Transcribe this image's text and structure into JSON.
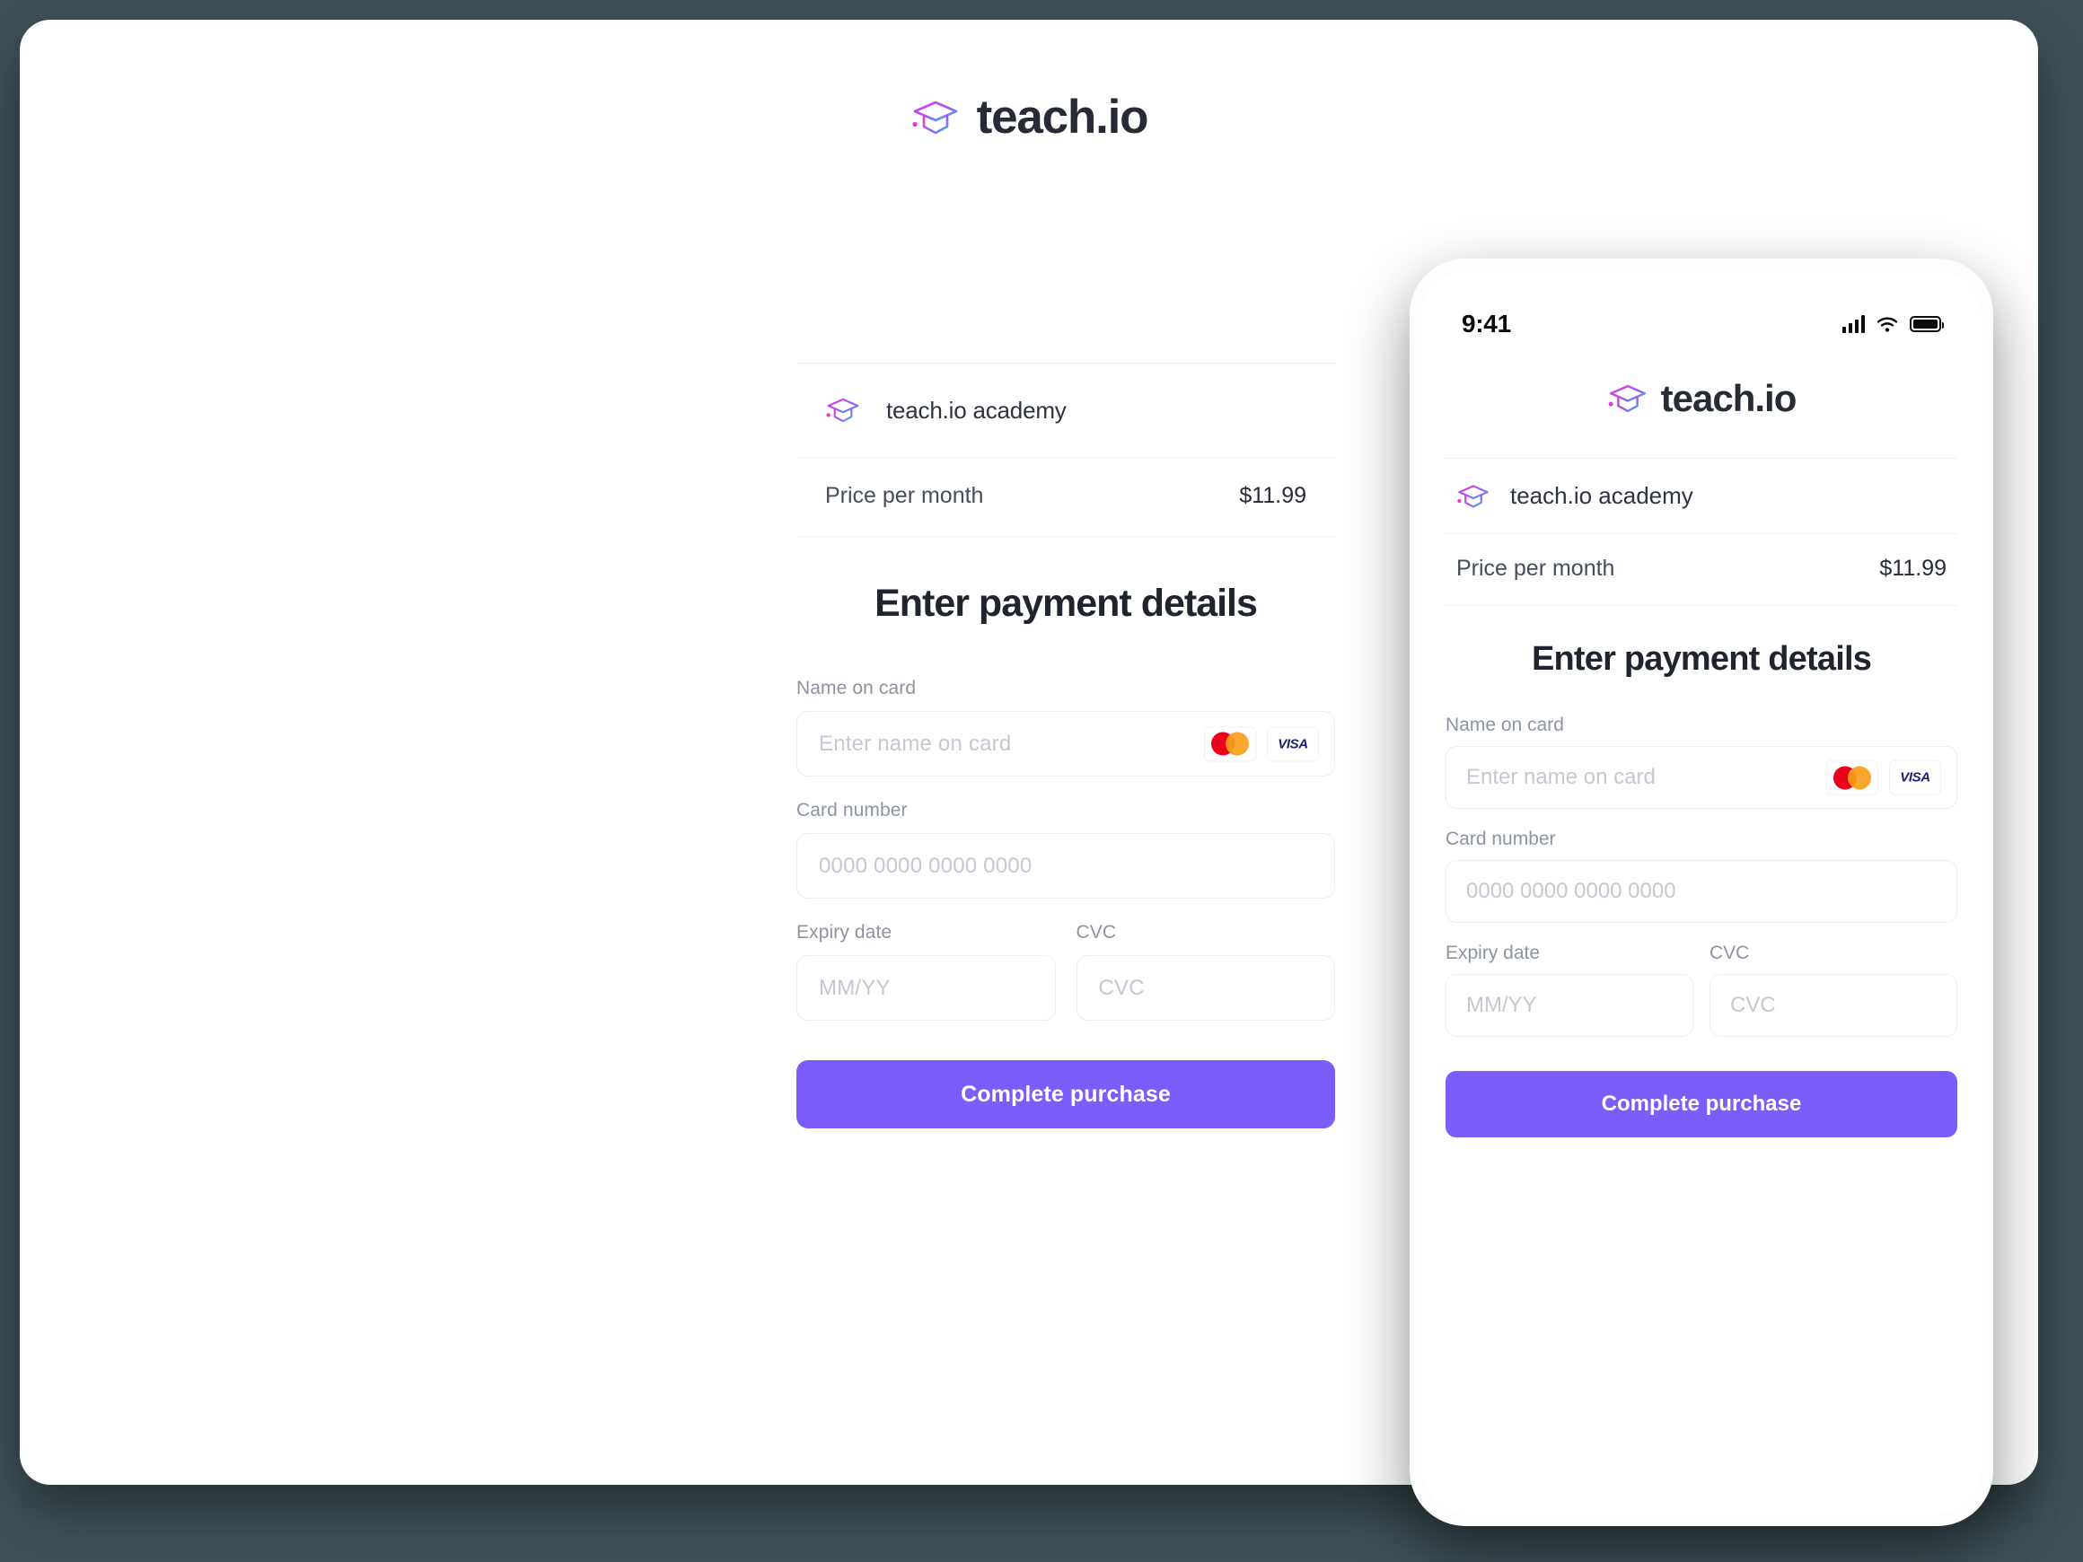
{
  "brand": {
    "name": "teach.io",
    "logo_icon": "graduation-cap-icon",
    "gradient_from": "#e838d8",
    "gradient_to": "#35b6f2"
  },
  "theme": {
    "background": "#3f5159",
    "surface": "#ffffff",
    "accent": "#7c5cfa",
    "text_primary": "#1f242e",
    "text_secondary": "#464d5c",
    "text_muted": "#8d94a1",
    "placeholder": "#c3c8d1",
    "border": "#eceef2",
    "divider": "#f1f2f5"
  },
  "desktop": {
    "checkout": {
      "merchant_name": "teach.io academy",
      "merchant_icon": "graduation-cap-icon",
      "price_label": "Price per month",
      "price_value": "$11.99",
      "section_title": "Enter payment details",
      "fields": [
        {
          "id": "name-on-card",
          "label": "Name on card",
          "placeholder": "Enter name on card",
          "value": ""
        },
        {
          "id": "card-number",
          "label": "Card number",
          "placeholder": "0000 0000 0000 0000",
          "value": ""
        },
        {
          "id": "expiry-date",
          "label": "Expiry date",
          "placeholder": "MM/YY",
          "value": ""
        },
        {
          "id": "cvc",
          "label": "CVC",
          "placeholder": "CVC",
          "value": ""
        }
      ],
      "card_brands": [
        {
          "name": "mastercard-icon",
          "label": ""
        },
        {
          "name": "visa-icon",
          "label": "VISA"
        }
      ],
      "submit_label": "Complete purchase"
    }
  },
  "mobile": {
    "status_bar": {
      "time": "9:41",
      "signal_icon": "cellular-signal-icon",
      "wifi_icon": "wifi-icon",
      "battery_icon": "battery-full-icon"
    },
    "brand_name": "teach.io",
    "checkout": {
      "merchant_name": "teach.io academy",
      "merchant_icon": "graduation-cap-icon",
      "price_label": "Price per month",
      "price_value": "$11.99",
      "section_title": "Enter payment details",
      "fields": [
        {
          "id": "name-on-card",
          "label": "Name on card",
          "placeholder": "Enter name on card",
          "value": ""
        },
        {
          "id": "card-number",
          "label": "Card number",
          "placeholder": "0000 0000 0000 0000",
          "value": ""
        },
        {
          "id": "expiry-date",
          "label": "Expiry date",
          "placeholder": "MM/YY",
          "value": ""
        },
        {
          "id": "cvc",
          "label": "CVC",
          "placeholder": "CVC",
          "value": ""
        }
      ],
      "card_brands": [
        {
          "name": "mastercard-icon",
          "label": ""
        },
        {
          "name": "visa-icon",
          "label": "VISA"
        }
      ],
      "submit_label": "Complete purchase"
    }
  }
}
